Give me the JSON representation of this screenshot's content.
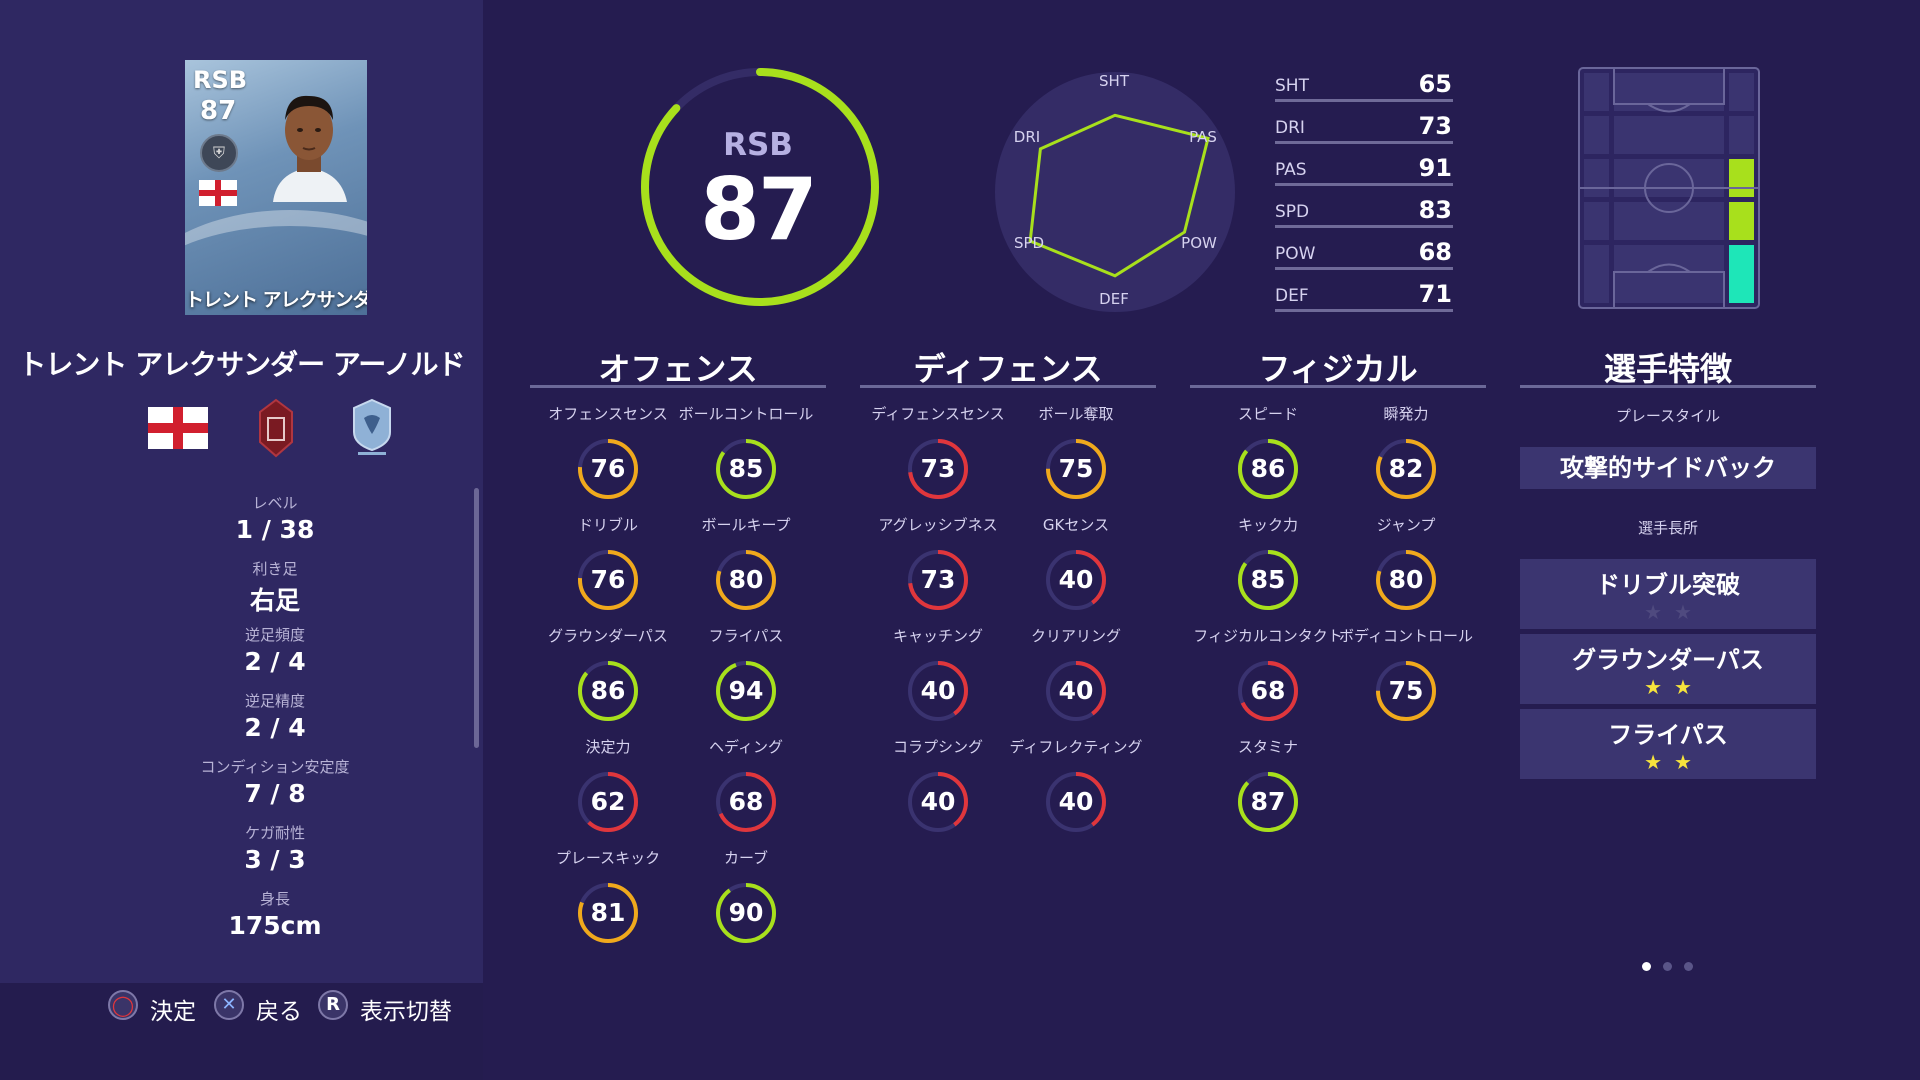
{
  "card": {
    "position": "RSB",
    "overall": "87",
    "name": "トレント アレクサンダー アーノルド"
  },
  "player": {
    "name": "トレント アレクサンダー アーノルド"
  },
  "info": [
    {
      "label": "レベル",
      "value": "1 / 38"
    },
    {
      "label": "利き足",
      "value": "右足"
    },
    {
      "label": "逆足頻度",
      "value": "2 / 4"
    },
    {
      "label": "逆足精度",
      "value": "2 / 4"
    },
    {
      "label": "コンディション安定度",
      "value": "7 / 8"
    },
    {
      "label": "ケガ耐性",
      "value": "3 / 3"
    },
    {
      "label": "身長",
      "value": "175cm"
    }
  ],
  "controls": [
    {
      "icon": "circle-button-icon",
      "glyph": "◯",
      "label": "決定"
    },
    {
      "icon": "cross-button-icon",
      "glyph": "✕",
      "label": "戻る"
    },
    {
      "icon": "r-button-icon",
      "glyph": "R",
      "label": "表示切替"
    }
  ],
  "overall_ring": {
    "position": "RSB",
    "value": "87",
    "fraction": 0.87,
    "color": "#a8e01c"
  },
  "radar": {
    "labels": [
      "SHT",
      "PAS",
      "POW",
      "DEF",
      "SPD",
      "DRI"
    ],
    "values": [
      65,
      91,
      68,
      71,
      83,
      73
    ]
  },
  "summary_stats": [
    {
      "label": "SHT",
      "value": "65"
    },
    {
      "label": "DRI",
      "value": "73"
    },
    {
      "label": "PAS",
      "value": "91"
    },
    {
      "label": "SPD",
      "value": "83"
    },
    {
      "label": "POW",
      "value": "68"
    },
    {
      "label": "DEF",
      "value": "71"
    }
  ],
  "sections": {
    "offense": {
      "title": "オフェンス",
      "stats": [
        {
          "label": "オフェンスセンス",
          "value": 76
        },
        {
          "label": "ボールコントロール",
          "value": 85
        },
        {
          "label": "ドリブル",
          "value": 76
        },
        {
          "label": "ボールキープ",
          "value": 80
        },
        {
          "label": "グラウンダーパス",
          "value": 86
        },
        {
          "label": "フライパス",
          "value": 94
        },
        {
          "label": "決定力",
          "value": 62
        },
        {
          "label": "ヘディング",
          "value": 68
        },
        {
          "label": "プレースキック",
          "value": 81
        },
        {
          "label": "カーブ",
          "value": 90
        }
      ]
    },
    "defense": {
      "title": "ディフェンス",
      "stats": [
        {
          "label": "ディフェンスセンス",
          "value": 73
        },
        {
          "label": "ボール奪取",
          "value": 75
        },
        {
          "label": "アグレッシブネス",
          "value": 73
        },
        {
          "label": "GKセンス",
          "value": 40
        },
        {
          "label": "キャッチング",
          "value": 40
        },
        {
          "label": "クリアリング",
          "value": 40
        },
        {
          "label": "コラプシング",
          "value": 40
        },
        {
          "label": "ディフレクティング",
          "value": 40
        }
      ]
    },
    "physical": {
      "title": "フィジカル",
      "stats": [
        {
          "label": "スピード",
          "value": 86
        },
        {
          "label": "瞬発力",
          "value": 82
        },
        {
          "label": "キック力",
          "value": 85
        },
        {
          "label": "ジャンプ",
          "value": 80
        },
        {
          "label": "フィジカルコンタクト",
          "value": 68
        },
        {
          "label": "ボディコントロール",
          "value": 75
        },
        {
          "label": "スタミナ",
          "value": 87
        }
      ]
    }
  },
  "traits": {
    "title": "選手特徴",
    "playstyle_label": "プレースタイル",
    "playstyle": "攻撃的サイドバック",
    "skills_label": "選手長所",
    "skills": [
      {
        "name": "ドリブル突破",
        "stars": 0
      },
      {
        "name": "グラウンダーパス",
        "stars": 2
      },
      {
        "name": "フライパス",
        "stars": 2
      }
    ]
  },
  "colors": {
    "green": "#a8e01c",
    "orange": "#f0a91c",
    "red": "#e0363c",
    "pitch_cyan": "#1ee6b8"
  },
  "pagination": {
    "total": 3,
    "active": 1
  }
}
